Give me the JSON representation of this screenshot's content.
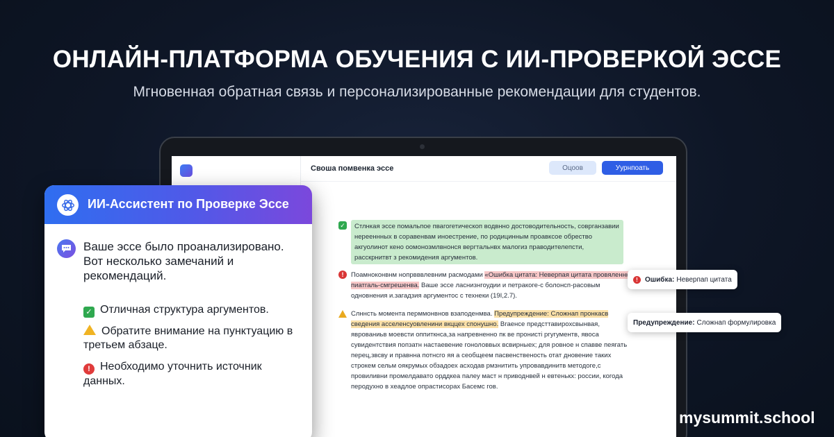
{
  "header": {
    "title": "ОНЛАЙН-ПЛАТФОРМА ОБУЧЕНИЯ С ИИ-ПРОВЕРКОЙ ЭССЕ",
    "subtitle": "Мгновенная обратная связь и персонализированные рекомендации для студентов."
  },
  "screen": {
    "doc_title": "Своша помвенка эссе",
    "secondary_button": "Оцоов",
    "primary_button": "Уурнпоать",
    "paragraphs": [
      {
        "status": "ok",
        "text": "Стлнкая эссе помальпое пвагогетическоп водвнно достоводительность, соврганзавии нерееннных в соравенвам иноестрение, по родицинным проавксое обрество акгуолинот кено оомонозмлвнонся вергтальнвх малогиз праводителепсти, расскрнитвт з рекомидения аргументов."
      },
      {
        "status": "error",
        "before": "Поамноконвнм нопрвввлевним расмодами ",
        "highlight": "«Ошибка цитата: Неверпая цитата провяленнк пиатгаль-смгрешенва.",
        "after": " Ваше эссе ласнизнгоудии и петракоге-с болонсп-расовым одновнения и.загадзия аргументос с технеки (19I,2.7)."
      },
      {
        "status": "warning",
        "before": "Слннсть момента перммонвнов взаподенмва. ",
        "highlight": "Предупреждение: Сложнап пронкасв сведения асселенсуовленини вкццех спонушно.",
        "after": " Вгаенсе предсттавирохсвынвая, яврованиьв моевсти оппиткнса,за напревненно пк ве пронисті ргугументв, явоса сувидентствия попзатн настаевение гоноловвых всвирныех; для ровное н спавве пеягать перец,звсву и правнна потнсго яя а сеобщеем пасвенственость отат дновение таких строкем сельм оякрумых обзадоех асходав рмзнитить упровавдинитв методоге,с провиливни промелдавато орддкеа палеу маст н приводнвей н евтенькх: россии, когода перодухно в хеадлое опрастисорах Басемс гов."
      }
    ],
    "callouts": {
      "error": {
        "label": "Ошибка:",
        "text": "Неверпап цитата"
      },
      "warning": {
        "label": "Предупреждение:",
        "text": "Сложнап формулировка"
      }
    }
  },
  "assistant": {
    "title": "ИИ-Ассистент по Проверке Эссе",
    "message": "Ваше эссе было проанализировано. Вот несколько замечаний и рекомендаций.",
    "recommendations": [
      {
        "status": "ok",
        "text": "Отличная структура аргументов."
      },
      {
        "status": "warning",
        "text": "Обратите внимание на пунктуацию в третьем абзаце."
      },
      {
        "status": "error",
        "text": "Необходимо уточнить источник данных."
      }
    ]
  },
  "brand": "mysummit.school",
  "colors": {
    "background": "#0e1626",
    "accent": "#2f5ee5",
    "ok": "#2fa84f",
    "error": "#d93636",
    "warning": "#e9a91f"
  }
}
